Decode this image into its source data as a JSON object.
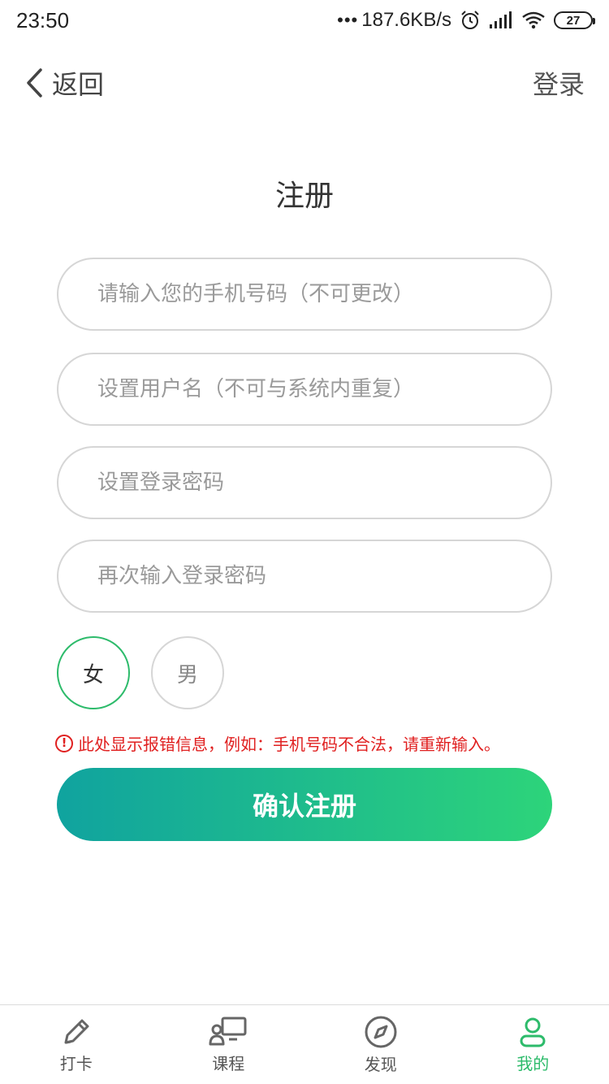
{
  "status_bar": {
    "time": "23:50",
    "net_speed": "187.6KB/s",
    "battery": "27",
    "icons": [
      "alarm-icon",
      "signal-icon",
      "wifi-icon",
      "battery-icon"
    ]
  },
  "nav": {
    "back_label": "返回",
    "login_label": "登录"
  },
  "page_title": "注册",
  "form": {
    "phone_placeholder": "请输入您的手机号码（不可更改）",
    "username_placeholder": "设置用户名（不可与系统内重复）",
    "password_placeholder": "设置登录密码",
    "password_confirm_placeholder": "再次输入登录密码",
    "gender_female": "女",
    "gender_male": "男",
    "selected_gender": "女",
    "error_message": "此处显示报错信息，例如：手机号码不合法，请重新输入。",
    "submit_label": "确认注册"
  },
  "tabs": [
    {
      "label": "打卡",
      "icon": "pencil-icon",
      "active": false
    },
    {
      "label": "课程",
      "icon": "classroom-icon",
      "active": false
    },
    {
      "label": "发现",
      "icon": "compass-icon",
      "active": false
    },
    {
      "label": "我的",
      "icon": "user-icon",
      "active": true
    }
  ],
  "colors": {
    "accent": "#2dbb6b",
    "gradient_start": "#10a39f",
    "gradient_end": "#2dd47a",
    "error": "#e02020"
  }
}
